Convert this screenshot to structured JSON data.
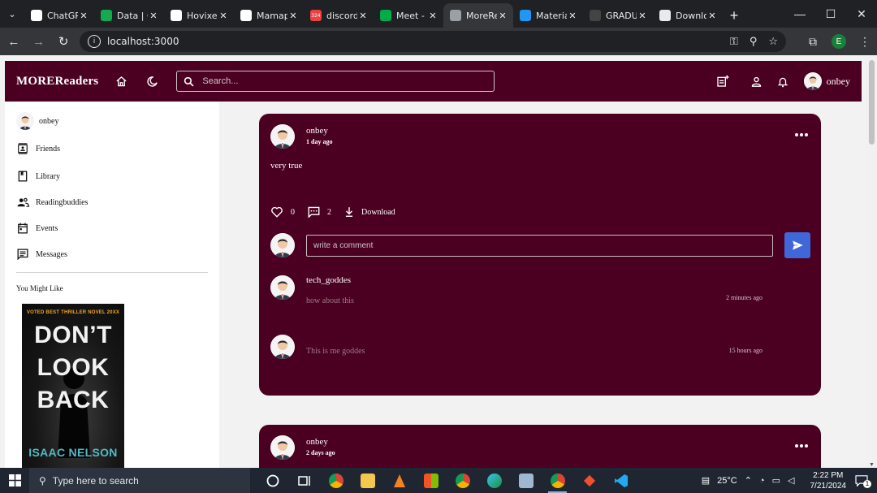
{
  "browser": {
    "tabs": [
      {
        "title": "ChatGP",
        "favicon_color": "#ffffff",
        "favicon_name": "chatgpt-favicon"
      },
      {
        "title": "Data | C",
        "favicon_color": "#13aa52",
        "favicon_name": "mongodb-favicon"
      },
      {
        "title": "Hovixe",
        "favicon_color": "#ffffff",
        "favicon_name": "github-favicon"
      },
      {
        "title": "Mamap",
        "favicon_color": "#ffffff",
        "favicon_name": "github-favicon"
      },
      {
        "title": "discord",
        "favicon_color": "#ed4245",
        "favicon_name": "discord-favicon",
        "badge": "324"
      },
      {
        "title": "Meet -",
        "favicon_color": "#00ac47",
        "favicon_name": "meet-favicon"
      },
      {
        "title": "MoreRe",
        "favicon_color": "#9aa0a6",
        "favicon_name": "globe-favicon",
        "active": true
      },
      {
        "title": "Materia",
        "favicon_color": "#2196f3",
        "favicon_name": "mui-favicon"
      },
      {
        "title": "GRADU",
        "favicon_color": "#444444",
        "favicon_name": "doc-favicon"
      },
      {
        "title": "Downlo",
        "favicon_color": "#e8eaed",
        "favicon_name": "download-favicon"
      }
    ],
    "url": "localhost:3000",
    "profile_initial": "E"
  },
  "app": {
    "brand": "MOREReaders",
    "search_placeholder": "Search...",
    "user": "onbey",
    "accent": "#4b0021",
    "send_color": "#3f67d8"
  },
  "sidebar": {
    "user": "onbey",
    "items": [
      {
        "label": "Friends",
        "icon": "contacts-icon"
      },
      {
        "label": "Library",
        "icon": "bookmark-icon"
      },
      {
        "label": "Readingbuddies",
        "icon": "people-icon"
      },
      {
        "label": "Events",
        "icon": "calendar-icon"
      },
      {
        "label": "Messages",
        "icon": "message-icon"
      }
    ],
    "suggest_heading": "You Might Like",
    "book": {
      "tagline": "VOTED BEST THRILLER NOVEL 20XX",
      "title_lines": [
        "DON’T",
        "LOOK",
        "BACK"
      ],
      "author": "ISAAC NELSON"
    }
  },
  "posts": [
    {
      "user": "onbey",
      "time": "1 day ago",
      "text": "very true",
      "likes": "0",
      "comments": "2",
      "download_label": "Download",
      "comment_placeholder": "write a comment",
      "comment_list": [
        {
          "user": "tech_goddes",
          "text": "how about this",
          "time": "2 minutes ago"
        },
        {
          "user": "",
          "text": "This is me goddes",
          "time": "15 hours ago"
        }
      ]
    },
    {
      "user": "onbey",
      "time": "2 days ago"
    }
  ],
  "taskbar": {
    "search_placeholder": "Type here to search",
    "temperature": "25°C",
    "time": "2:22 PM",
    "date": "7/21/2024",
    "notification_count": "1"
  }
}
